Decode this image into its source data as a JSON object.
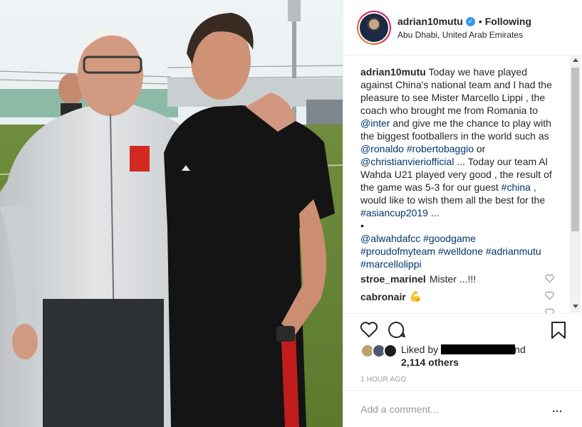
{
  "header": {
    "username": "adrian10mutu",
    "following_label": "Following",
    "separator": "•",
    "location": "Abu Dhabi, United Arab Emirates"
  },
  "caption": {
    "username": "adrian10mutu",
    "lines": [
      "Today we have played",
      "against China's national team and I had the",
      "pleasure to see Mister Marcello Lippi , the",
      "coach who brought me from Romania to"
    ],
    "tag_inter": "@inter",
    "line5_rest": " and give me the chance to play with",
    "line6": "the biggest footballers in the world such as",
    "tag_ronaldo": "@ronaldo",
    "tag_roberto": "#robertobaggio",
    "or": " or",
    "tag_vieri": "@christianvieriofficial",
    "line8_rest": " ... Today our team Al",
    "line9": "Wahda U21 played very good , the result of",
    "line10_pre": "the game was 5-3 for our guest ",
    "tag_china": "#china",
    "line10_post": " ,",
    "line11": "would like to wish them all the best for the",
    "tag_asiancup": "#asiancup2019",
    "line12_post": " ...",
    "bullet": "•",
    "tags_a": "@alwahdafcc #goodgame",
    "tags_b": "#proudofmyteam #welldone #adrianmutu",
    "tags_c": "#marcellolippi"
  },
  "comments": [
    {
      "username": "stroe_marinel",
      "text": "Mister ...!!!"
    },
    {
      "username": "cabronair",
      "text": ""
    },
    {
      "username": "...",
      "text": ""
    }
  ],
  "likes": {
    "prefix": "Liked by",
    "suffix": "nd",
    "count_text": "2,114 others"
  },
  "timestamp": "1 HOUR AGO",
  "add_comment": {
    "placeholder": "Add a comment...",
    "more": "..."
  },
  "colors": {
    "link": "#003569",
    "verified": "#3897f0",
    "muted": "#999999"
  },
  "icons": [
    "verified-icon",
    "heart-icon",
    "comment-icon",
    "bookmark-icon",
    "more-icon"
  ]
}
